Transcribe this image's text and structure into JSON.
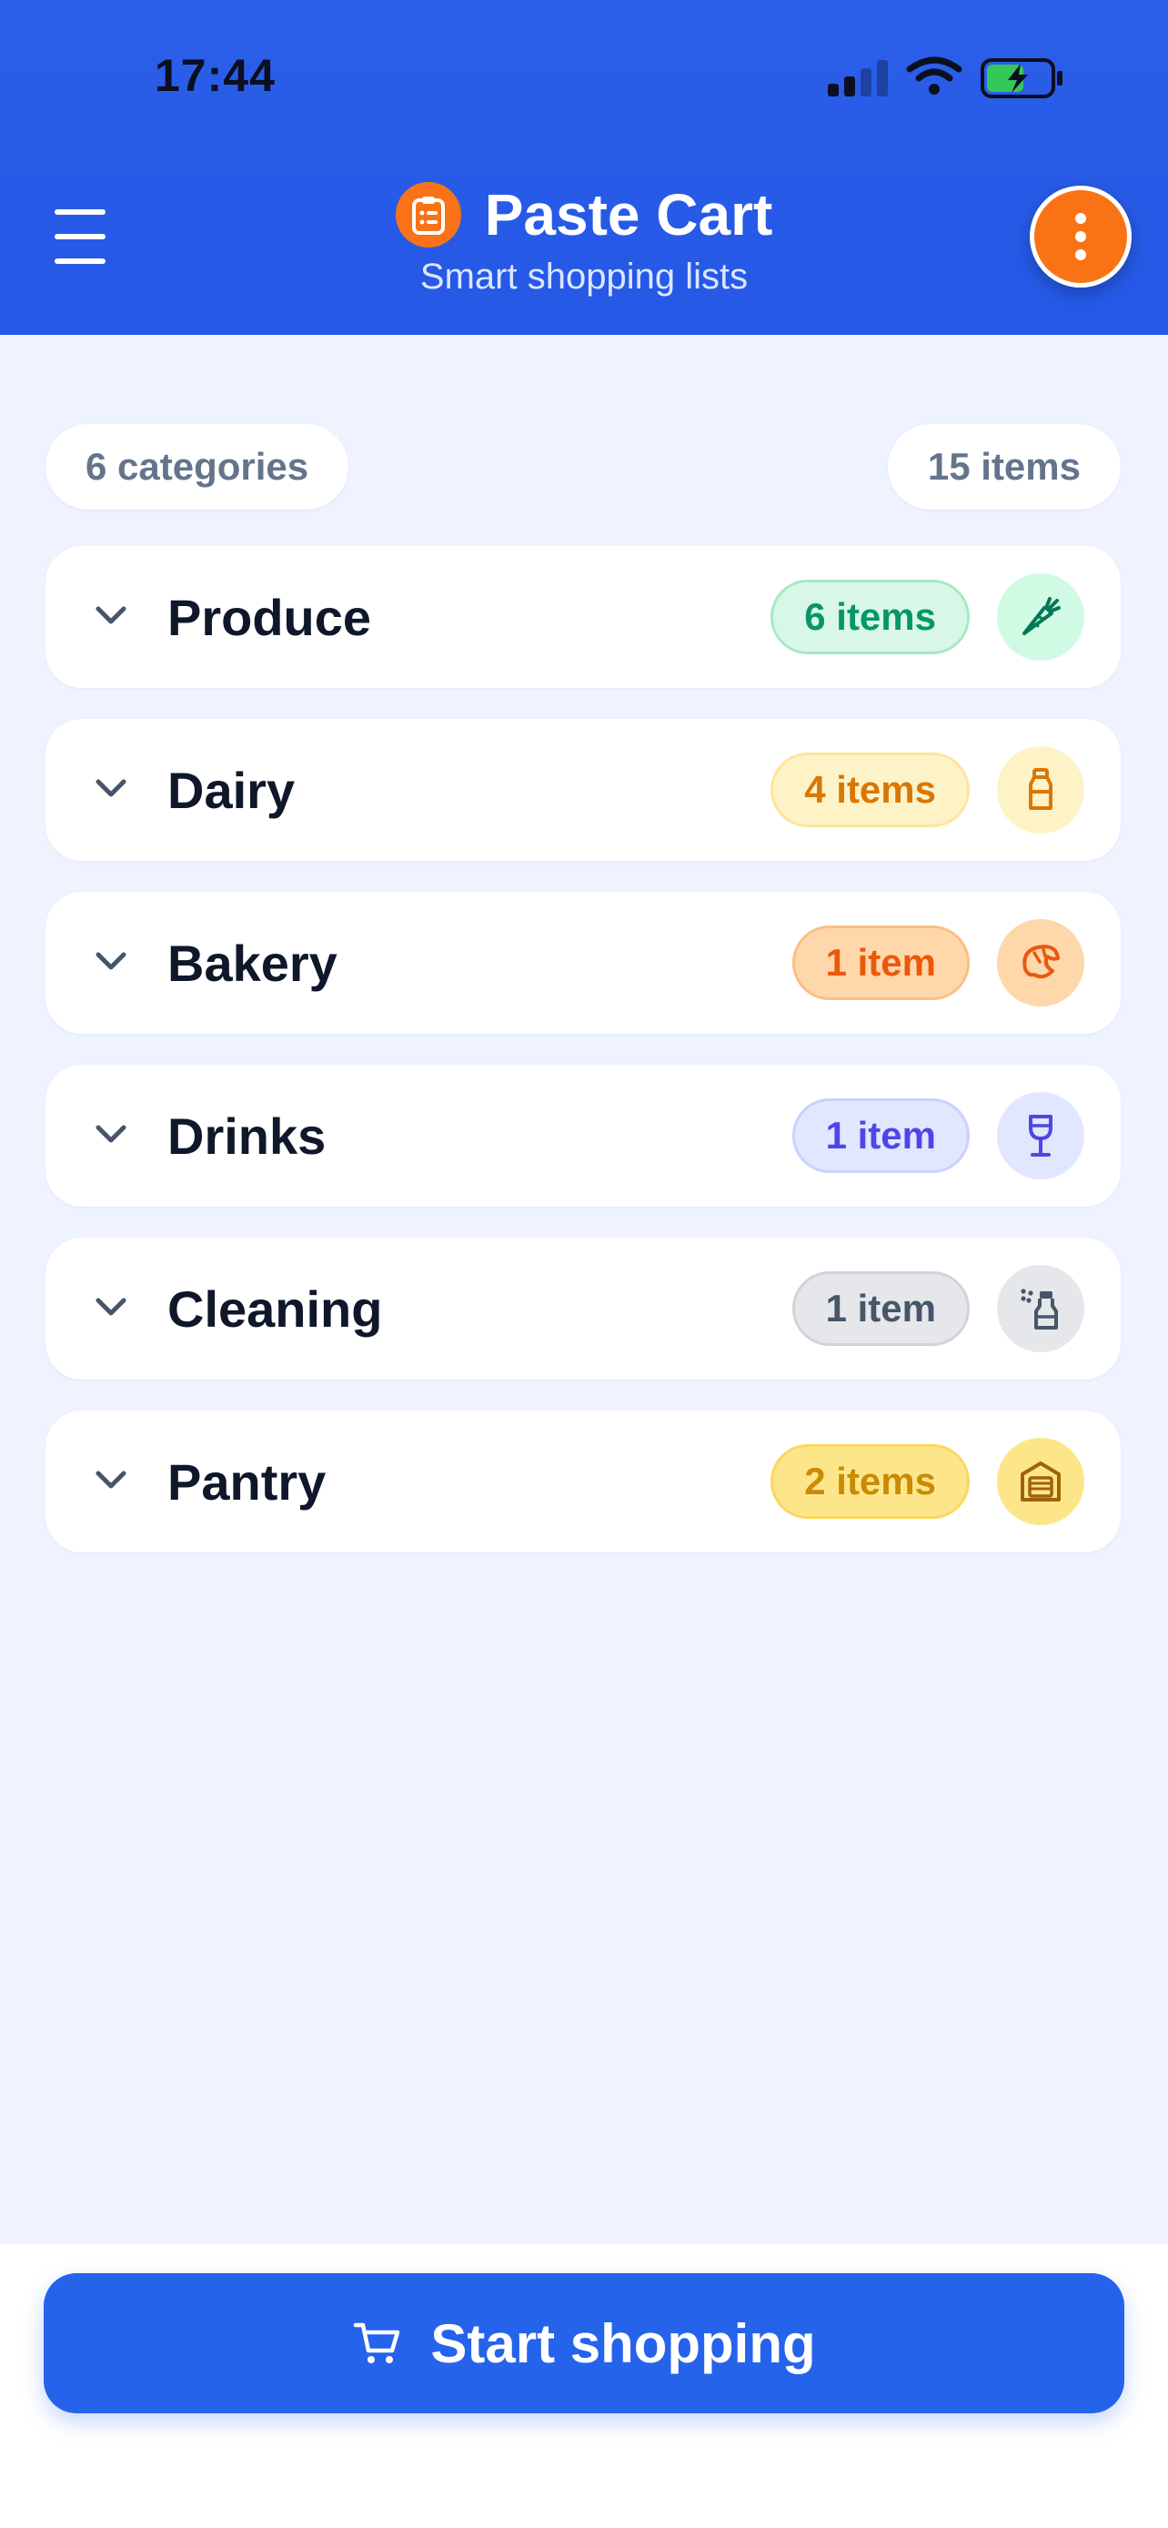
{
  "status_bar": {
    "time": "17:44"
  },
  "header": {
    "title": "Paste Cart",
    "subtitle": "Smart shopping lists"
  },
  "summary": {
    "categories_label": "6 categories",
    "items_label": "15 items"
  },
  "categories": [
    {
      "name": "Produce",
      "count": "6 items",
      "icon": "carrot-icon",
      "pill_bg": "#d9f7e6",
      "pill_border": "#a7e9c4",
      "pill_text": "#059669",
      "icon_bg": "#d1fae5",
      "icon_color": "#047857"
    },
    {
      "name": "Dairy",
      "count": "4 items",
      "icon": "milk-bottle-icon",
      "pill_bg": "#fef3c7",
      "pill_border": "#fde59a",
      "pill_text": "#d97706",
      "icon_bg": "#fef3c7",
      "icon_color": "#d97706"
    },
    {
      "name": "Bakery",
      "count": "1 item",
      "icon": "croissant-icon",
      "pill_bg": "#fed7aa",
      "pill_border": "#fbbf84",
      "pill_text": "#ea580c",
      "icon_bg": "#fed7aa",
      "icon_color": "#ea580c"
    },
    {
      "name": "Drinks",
      "count": "1 item",
      "icon": "wine-glass-icon",
      "pill_bg": "#e0e7ff",
      "pill_border": "#c7d2fe",
      "pill_text": "#4f46e5",
      "icon_bg": "#e0e7ff",
      "icon_color": "#4f46e5"
    },
    {
      "name": "Cleaning",
      "count": "1 item",
      "icon": "spray-bottle-icon",
      "pill_bg": "#e5e7eb",
      "pill_border": "#cfd4da",
      "pill_text": "#475569",
      "icon_bg": "#e5e7eb",
      "icon_color": "#475569"
    },
    {
      "name": "Pantry",
      "count": "2 items",
      "icon": "pantry-box-icon",
      "pill_bg": "#fde68a",
      "pill_border": "#fcd75e",
      "pill_text": "#ca8a04",
      "icon_bg": "#fde68a",
      "icon_color": "#a16207"
    }
  ],
  "footer": {
    "start_label": "Start shopping"
  },
  "colors": {
    "header_blue": "#2458e6",
    "accent_orange": "#f97316",
    "primary_button": "#2563eb",
    "background": "#eef3ff"
  }
}
